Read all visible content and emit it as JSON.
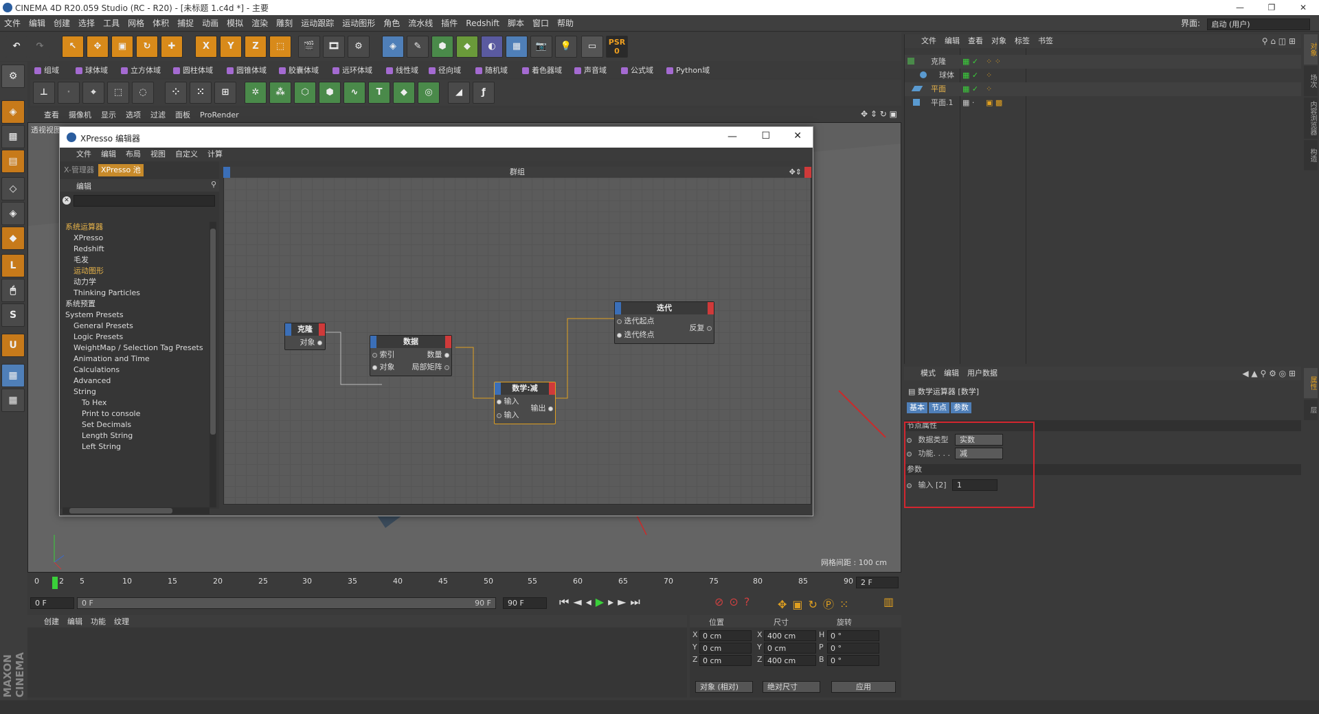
{
  "window": {
    "title": "CINEMA 4D R20.059 Studio (RC - R20) - [未标题 1.c4d *] - 主要"
  },
  "menubar": {
    "items": [
      "文件",
      "编辑",
      "创建",
      "选择",
      "工具",
      "网格",
      "体积",
      "捕捉",
      "动画",
      "模拟",
      "渲染",
      "雕刻",
      "运动跟踪",
      "运动图形",
      "角色",
      "流水线",
      "插件",
      "Redshift",
      "脚本",
      "窗口",
      "帮助"
    ],
    "layout_label": "界面:",
    "layout_value": "启动 (用户)"
  },
  "toolbar": {
    "top_buttons": [
      "X",
      "Y",
      "Z"
    ],
    "psr_label": "PSR",
    "psr_value": "0"
  },
  "fields_bar": {
    "items": [
      "组域",
      "球体域",
      "立方体域",
      "圆柱体域",
      "圆锥体域",
      "胶囊体域",
      "远环体域",
      "线性域",
      "径向域",
      "随机域",
      "着色器域",
      "声音域",
      "公式域",
      "Python域"
    ]
  },
  "viewport": {
    "menu": [
      "查看",
      "摄像机",
      "显示",
      "选项",
      "过滤",
      "面板",
      "ProRender"
    ],
    "corner_label": "透视视图",
    "grid_label": "网格间距 : 100 cm"
  },
  "xpresso": {
    "title": "XPresso 编辑器",
    "menu": [
      "文件",
      "编辑",
      "布局",
      "视图",
      "自定义",
      "计算"
    ],
    "tabs": [
      "X-管理器",
      "XPresso 池"
    ],
    "left_header": "编辑",
    "group_title": "群组",
    "tree": [
      {
        "label": "系统运算器",
        "level": 0,
        "color": "#e8b44a"
      },
      {
        "label": "XPresso",
        "level": 1,
        "color": "#dddddd"
      },
      {
        "label": "Redshift",
        "level": 1,
        "color": "#dddddd"
      },
      {
        "label": "毛发",
        "level": 1,
        "color": "#dddddd"
      },
      {
        "label": "运动图形",
        "level": 1,
        "color": "#e8b44a"
      },
      {
        "label": "动力学",
        "level": 1,
        "color": "#dddddd"
      },
      {
        "label": "Thinking Particles",
        "level": 1,
        "color": "#dddddd"
      },
      {
        "label": "系统预置",
        "level": 0,
        "color": "#dddddd"
      },
      {
        "label": "System Presets",
        "level": 0,
        "color": "#dddddd"
      },
      {
        "label": "General Presets",
        "level": 1,
        "color": "#dddddd"
      },
      {
        "label": "Logic Presets",
        "level": 1,
        "color": "#dddddd"
      },
      {
        "label": "WeightMap / Selection Tag Presets",
        "level": 1,
        "color": "#dddddd"
      },
      {
        "label": "Animation and Time",
        "level": 1,
        "color": "#dddddd"
      },
      {
        "label": "Calculations",
        "level": 1,
        "color": "#dddddd"
      },
      {
        "label": "Advanced",
        "level": 1,
        "color": "#dddddd"
      },
      {
        "label": "String",
        "level": 1,
        "color": "#dddddd"
      },
      {
        "label": "To Hex",
        "level": 2,
        "color": "#dddddd"
      },
      {
        "label": "Print to console",
        "level": 2,
        "color": "#dddddd"
      },
      {
        "label": "Set Decimals",
        "level": 2,
        "color": "#dddddd"
      },
      {
        "label": "Length String",
        "level": 2,
        "color": "#dddddd"
      },
      {
        "label": "Left String",
        "level": 2,
        "color": "#dddddd"
      }
    ],
    "nodes": {
      "clone": {
        "title": "克隆",
        "out1": "对象"
      },
      "data": {
        "title": "数据",
        "in1": "索引",
        "in2": "对象",
        "out1": "数量",
        "out2": "局部矩阵"
      },
      "math": {
        "title": "数学:减",
        "in1": "输入",
        "in2": "输入",
        "out1": "输出"
      },
      "iter": {
        "title": "迭代",
        "in1": "迭代起点",
        "in2": "迭代终点",
        "out1": "反复"
      }
    }
  },
  "objects": {
    "menu": [
      "文件",
      "编辑",
      "查看",
      "对象",
      "标签",
      "书签"
    ],
    "rows": [
      {
        "name": "克隆",
        "indent": 0,
        "color": "#dddddd"
      },
      {
        "name": "球体",
        "indent": 1,
        "color": "#dddddd"
      },
      {
        "name": "平面",
        "indent": 0,
        "color": "#e8b44a"
      },
      {
        "name": "平面.1",
        "indent": 0,
        "color": "#dddddd"
      }
    ]
  },
  "attributes": {
    "menu": [
      "模式",
      "编辑",
      "用户数据"
    ],
    "object_title": "数学运算器 [数学]",
    "tabs": [
      "基本",
      "节点",
      "参数"
    ],
    "section_node": "节点属性",
    "data_type_label": "数据类型",
    "data_type_value": "实数",
    "function_label": "功能. . . .",
    "function_value": "减",
    "section_params": "参数",
    "input_label": "输入 [2]",
    "input_value": "1"
  },
  "timeline": {
    "ticks": [
      "0",
      "2",
      "5",
      "10",
      "15",
      "20",
      "25",
      "30",
      "35",
      "40",
      "45",
      "50",
      "55",
      "60",
      "65",
      "70",
      "75",
      "80",
      "85",
      "90"
    ],
    "current_frame": "2 F",
    "start": "0 F",
    "range_start": "0 F",
    "range_end": "90 F",
    "end": "90 F"
  },
  "material": {
    "menu": [
      "创建",
      "编辑",
      "功能",
      "纹理"
    ]
  },
  "coords": {
    "headers": [
      "位置",
      "尺寸",
      "旋转"
    ],
    "rows": [
      {
        "axis": "X",
        "pos": "0 cm",
        "size_axis": "X",
        "size": "400 cm",
        "rot_axis": "H",
        "rot": "0 °"
      },
      {
        "axis": "Y",
        "pos": "0 cm",
        "size_axis": "Y",
        "size": "0 cm",
        "rot_axis": "P",
        "rot": "0 °"
      },
      {
        "axis": "Z",
        "pos": "0 cm",
        "size_axis": "Z",
        "size": "400 cm",
        "rot_axis": "B",
        "rot": "0 °"
      }
    ],
    "mode": "对象 (相对)",
    "size_mode": "绝对尺寸",
    "apply": "应用"
  },
  "brand": "MAXON CINEMA 4D",
  "right_tabs": [
    "对象",
    "场次",
    "内容浏览器",
    "构造",
    "属性",
    "层"
  ]
}
